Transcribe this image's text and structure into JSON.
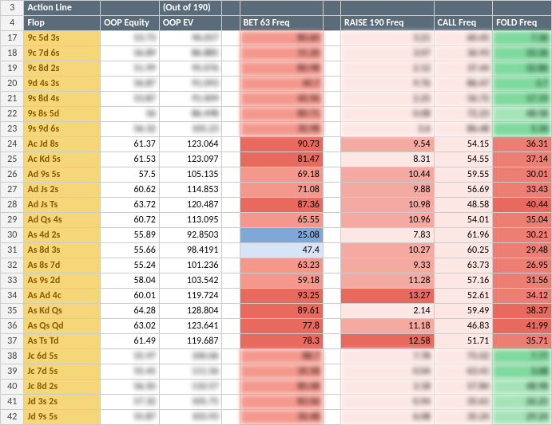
{
  "headers": {
    "row3": {
      "action_line": "Action Line",
      "out_of": "(Out of 190)"
    },
    "row4": {
      "flop": "Flop",
      "oop_equity": "OOP Equity",
      "oop_ev": "OOP EV",
      "bet63": "BET 63 Freq",
      "raise190": "RAISE 190 Freq",
      "call": "CALL Freq",
      "fold": "FOLD Freq"
    }
  },
  "rows": [
    {
      "n": 17,
      "flop": "9c 5d 3s",
      "blurred": true,
      "eq_blur": "53.73",
      "ev_blur": "96.057",
      "bet_blur": "80.60",
      "raise_blur": "3.21",
      "call_blur": "60.45",
      "fold_blur": "7.36",
      "fold_cls": "fold-green"
    },
    {
      "n": 18,
      "flop": "9c 7d 6s",
      "blurred": true,
      "eq_blur": "56.89",
      "ev_blur": "86.885",
      "bet_blur": "31.20",
      "raise_blur": "3.07",
      "call_blur": "36.93",
      "fold_blur": "33.36",
      "fold_cls": "fold-green"
    },
    {
      "n": 19,
      "flop": "9c 8d 2s",
      "blurred": true,
      "eq_blur": "51.99",
      "ev_blur": "95.076",
      "bet_blur": "80.98",
      "raise_blur": "2.12",
      "call_blur": "37.44",
      "fold_blur": "32.86",
      "fold_cls": "fold-green"
    },
    {
      "n": 20,
      "flop": "9d 4s 3s",
      "blurred": true,
      "eq_blur": "56.87",
      "ev_blur": "91.093",
      "bet_blur": "40.7",
      "raise_blur": "9.76",
      "call_blur": "86.47",
      "fold_blur": "3.7",
      "fold_cls": "fold-green"
    },
    {
      "n": 21,
      "flop": "9s 8d 4s",
      "blurred": true,
      "eq_blur": "53.87",
      "ev_blur": "91.009",
      "bet_blur": "40.96",
      "raise_blur": "2.25",
      "call_blur": "56.72",
      "fold_blur": "17.19",
      "fold_cls": "fold-green"
    },
    {
      "n": 22,
      "flop": "9s 8s 5d",
      "blurred": true,
      "eq_blur": "56",
      "ev_blur": "86.498",
      "bet_blur": "80.71",
      "raise_blur": "0.08",
      "call_blur": "72.23",
      "fold_blur": "48.58",
      "fold_cls": "fold-greenm"
    },
    {
      "n": 23,
      "flop": "9s 9d 6s",
      "blurred": true,
      "eq_blur": "56.32",
      "ev_blur": "105.23",
      "bet_blur": "30.98",
      "raise_blur": "3.6",
      "call_blur": "86.48",
      "fold_blur": "5.34",
      "fold_cls": "fold-green"
    },
    {
      "n": 24,
      "flop": "Ac Jd 8s",
      "eq": "61.37",
      "ev": "123.064",
      "bet": "90.73",
      "bet_cls": "bet-high",
      "raise": "9.54",
      "raise_cls": "raise-med",
      "call": "54.15",
      "fold": "36.31",
      "fold_cls": "fold-redm"
    },
    {
      "n": 25,
      "flop": "Ac Kd 5s",
      "eq": "61.53",
      "ev": "123.097",
      "bet": "81.47",
      "bet_cls": "bet-high",
      "raise": "8.31",
      "raise_cls": "raise-low",
      "call": "54.55",
      "fold": "37.14",
      "fold_cls": "fold-redm"
    },
    {
      "n": 26,
      "flop": "Ad 9s 5s",
      "eq": "57.5",
      "ev": "105.135",
      "bet": "69.18",
      "bet_cls": "bet-med",
      "raise": "10.44",
      "raise_cls": "raise-med",
      "call": "59.55",
      "fold": "30.01",
      "fold_cls": "fold-redm"
    },
    {
      "n": 27,
      "flop": "Ad Js 2s",
      "eq": "60.62",
      "ev": "114.853",
      "bet": "71.08",
      "bet_cls": "bet-med",
      "raise": "9.88",
      "raise_cls": "raise-med",
      "call": "56.69",
      "fold": "33.43",
      "fold_cls": "fold-redm"
    },
    {
      "n": 28,
      "flop": "Ad Js Ts",
      "eq": "63.72",
      "ev": "120.487",
      "bet": "87.36",
      "bet_cls": "bet-high",
      "raise": "10.98",
      "raise_cls": "raise-med",
      "call": "48.58",
      "fold": "40.44",
      "fold_cls": "fold-red"
    },
    {
      "n": 29,
      "flop": "Ad Qs 4s",
      "eq": "60.72",
      "ev": "113.095",
      "bet": "65.55",
      "bet_cls": "bet-med",
      "raise": "10.96",
      "raise_cls": "raise-med",
      "call": "54.01",
      "fold": "35.04",
      "fold_cls": "fold-redm"
    },
    {
      "n": 30,
      "flop": "As 4d 2s",
      "eq": "55.89",
      "ev": "92.8503",
      "bet": "25.08",
      "bet_cls": "bet-blue",
      "raise": "7.83",
      "raise_cls": "raise-low",
      "call": "61.96",
      "fold": "30.21",
      "fold_cls": "fold-redm"
    },
    {
      "n": 31,
      "flop": "As 8d 3s",
      "eq": "55.66",
      "ev": "98.4191",
      "bet": "47.4",
      "bet_cls": "bet-low",
      "raise": "10.27",
      "raise_cls": "raise-med",
      "call": "60.25",
      "fold": "29.48",
      "fold_cls": "fold-redm"
    },
    {
      "n": 32,
      "flop": "As 8s 7d",
      "eq": "55.24",
      "ev": "101.236",
      "bet": "63.23",
      "bet_cls": "bet-med",
      "raise": "9.33",
      "raise_cls": "raise-med",
      "call": "63.73",
      "fold": "26.95",
      "fold_cls": "fold-redm"
    },
    {
      "n": 33,
      "flop": "As 9s 2d",
      "eq": "58.04",
      "ev": "103.542",
      "bet": "59.18",
      "bet_cls": "bet-med",
      "raise": "11.28",
      "raise_cls": "raise-med",
      "call": "57.16",
      "fold": "31.56",
      "fold_cls": "fold-redm"
    },
    {
      "n": 34,
      "flop": "As Ad 4c",
      "eq": "60.01",
      "ev": "119.724",
      "bet": "93.25",
      "bet_cls": "bet-high",
      "raise": "13.27",
      "raise_cls": "raise-high",
      "call": "52.61",
      "fold": "34.12",
      "fold_cls": "fold-redm"
    },
    {
      "n": 35,
      "flop": "As Kd Qs",
      "eq": "64.28",
      "ev": "128.804",
      "bet": "89.61",
      "bet_cls": "bet-high",
      "raise": "2.14",
      "raise_cls": "raise-low",
      "call": "59.49",
      "fold": "38.37",
      "fold_cls": "fold-red"
    },
    {
      "n": 36,
      "flop": "As Qs Qd",
      "eq": "63.02",
      "ev": "123.641",
      "bet": "77.8",
      "bet_cls": "bet-high",
      "raise": "11.18",
      "raise_cls": "raise-med",
      "call": "46.83",
      "fold": "41.99",
      "fold_cls": "fold-red"
    },
    {
      "n": 37,
      "flop": "As Ts Td",
      "eq": "61.49",
      "ev": "119.687",
      "bet": "78.3",
      "bet_cls": "bet-high",
      "raise": "12.58",
      "raise_cls": "raise-high",
      "call": "51.71",
      "fold": "35.71",
      "fold_cls": "fold-redm"
    },
    {
      "n": 38,
      "flop": "Jc 6d 5s",
      "blurred": true,
      "eq_blur": "55.97",
      "ev_blur": "100.06",
      "bet_blur": "88.7",
      "raise_blur": "7.78",
      "call_blur": "75.02",
      "fold_blur": "7.77",
      "fold_cls": "fold-green"
    },
    {
      "n": 39,
      "flop": "Jc 7d 5s",
      "blurred": true,
      "eq_blur": "55.45",
      "ev_blur": "111.56",
      "bet_blur": "30.58",
      "raise_blur": "0.04",
      "call_blur": "63.41",
      "fold_blur": "3.68",
      "fold_cls": "fold-green"
    },
    {
      "n": 40,
      "flop": "Jc 8d 2s",
      "blurred": true,
      "eq_blur": "56.50",
      "ev_blur": "110.57",
      "bet_blur": "80.48",
      "raise_blur": "3.18",
      "call_blur": "57.84",
      "fold_blur": "48.98",
      "fold_cls": "fold-greenm"
    },
    {
      "n": 41,
      "flop": "Jd 3s 2s",
      "blurred": true,
      "eq_blur": "57.32",
      "ev_blur": "105.75",
      "bet_blur": "82.06",
      "raise_blur": "0.94",
      "call_blur": "35.61",
      "fold_blur": "26.25",
      "fold_cls": "fold-greenm"
    },
    {
      "n": 42,
      "flop": "Jd 9s 5s",
      "blurred": true,
      "eq_blur": "55.87",
      "ev_blur": "103.93",
      "bet_blur": "30.48",
      "raise_blur": "6.08",
      "call_blur": "35.24",
      "fold_blur": "29.24",
      "fold_cls": "fold-greenm"
    }
  ]
}
